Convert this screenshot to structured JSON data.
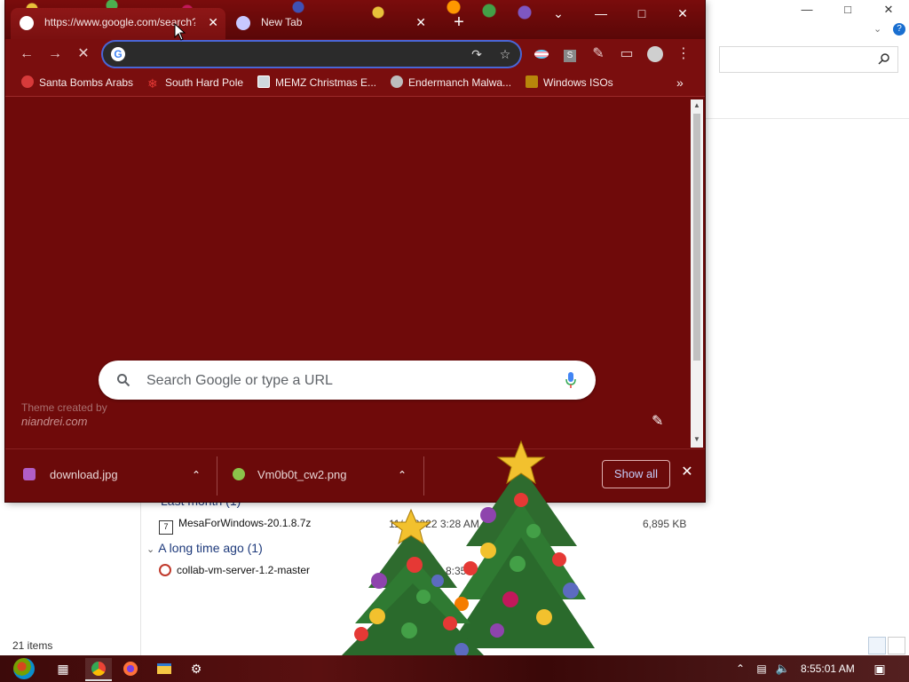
{
  "explorer": {
    "group_last_month": "Last month (1)",
    "group_long_ago": "A long time ago (1)",
    "files": [
      {
        "name": "MesaForWindows-20.1.8.7z",
        "date": "11/…2022 3:28 AM",
        "size": "6,895 KB"
      },
      {
        "name": "collab-vm-server-1.2-master",
        "date": "…8:35 P",
        "size": ""
      }
    ],
    "status_items": "21 items"
  },
  "chrome": {
    "tabs": [
      {
        "title": "https://www.google.com/search?"
      },
      {
        "title": "New Tab"
      }
    ],
    "bookmarks": [
      {
        "label": "Santa Bombs Arabs",
        "icon": "santa-icon"
      },
      {
        "label": "South Hard Pole",
        "icon": "snowflake-icon"
      },
      {
        "label": "MEMZ Christmas E...",
        "icon": "image-icon"
      },
      {
        "label": "Endermanch Malwa...",
        "icon": "skull-icon"
      },
      {
        "label": "Windows ISOs",
        "icon": "folder-icon"
      }
    ],
    "omnibox_value": "",
    "search_placeholder": "Search Google or type a URL",
    "theme_credit": "Theme created by",
    "theme_site": "niandrei.com",
    "downloads": [
      {
        "name": "download.jpg"
      },
      {
        "name": "Vm0b0t_cw2.png"
      }
    ],
    "show_all": "Show all"
  },
  "taskbar": {
    "clock": "8:55:01 AM"
  },
  "colors": {
    "chrome_bg": "#6b0a0a",
    "accent_blue": "#4a66d6",
    "explorer_group": "#1e3a7b"
  }
}
